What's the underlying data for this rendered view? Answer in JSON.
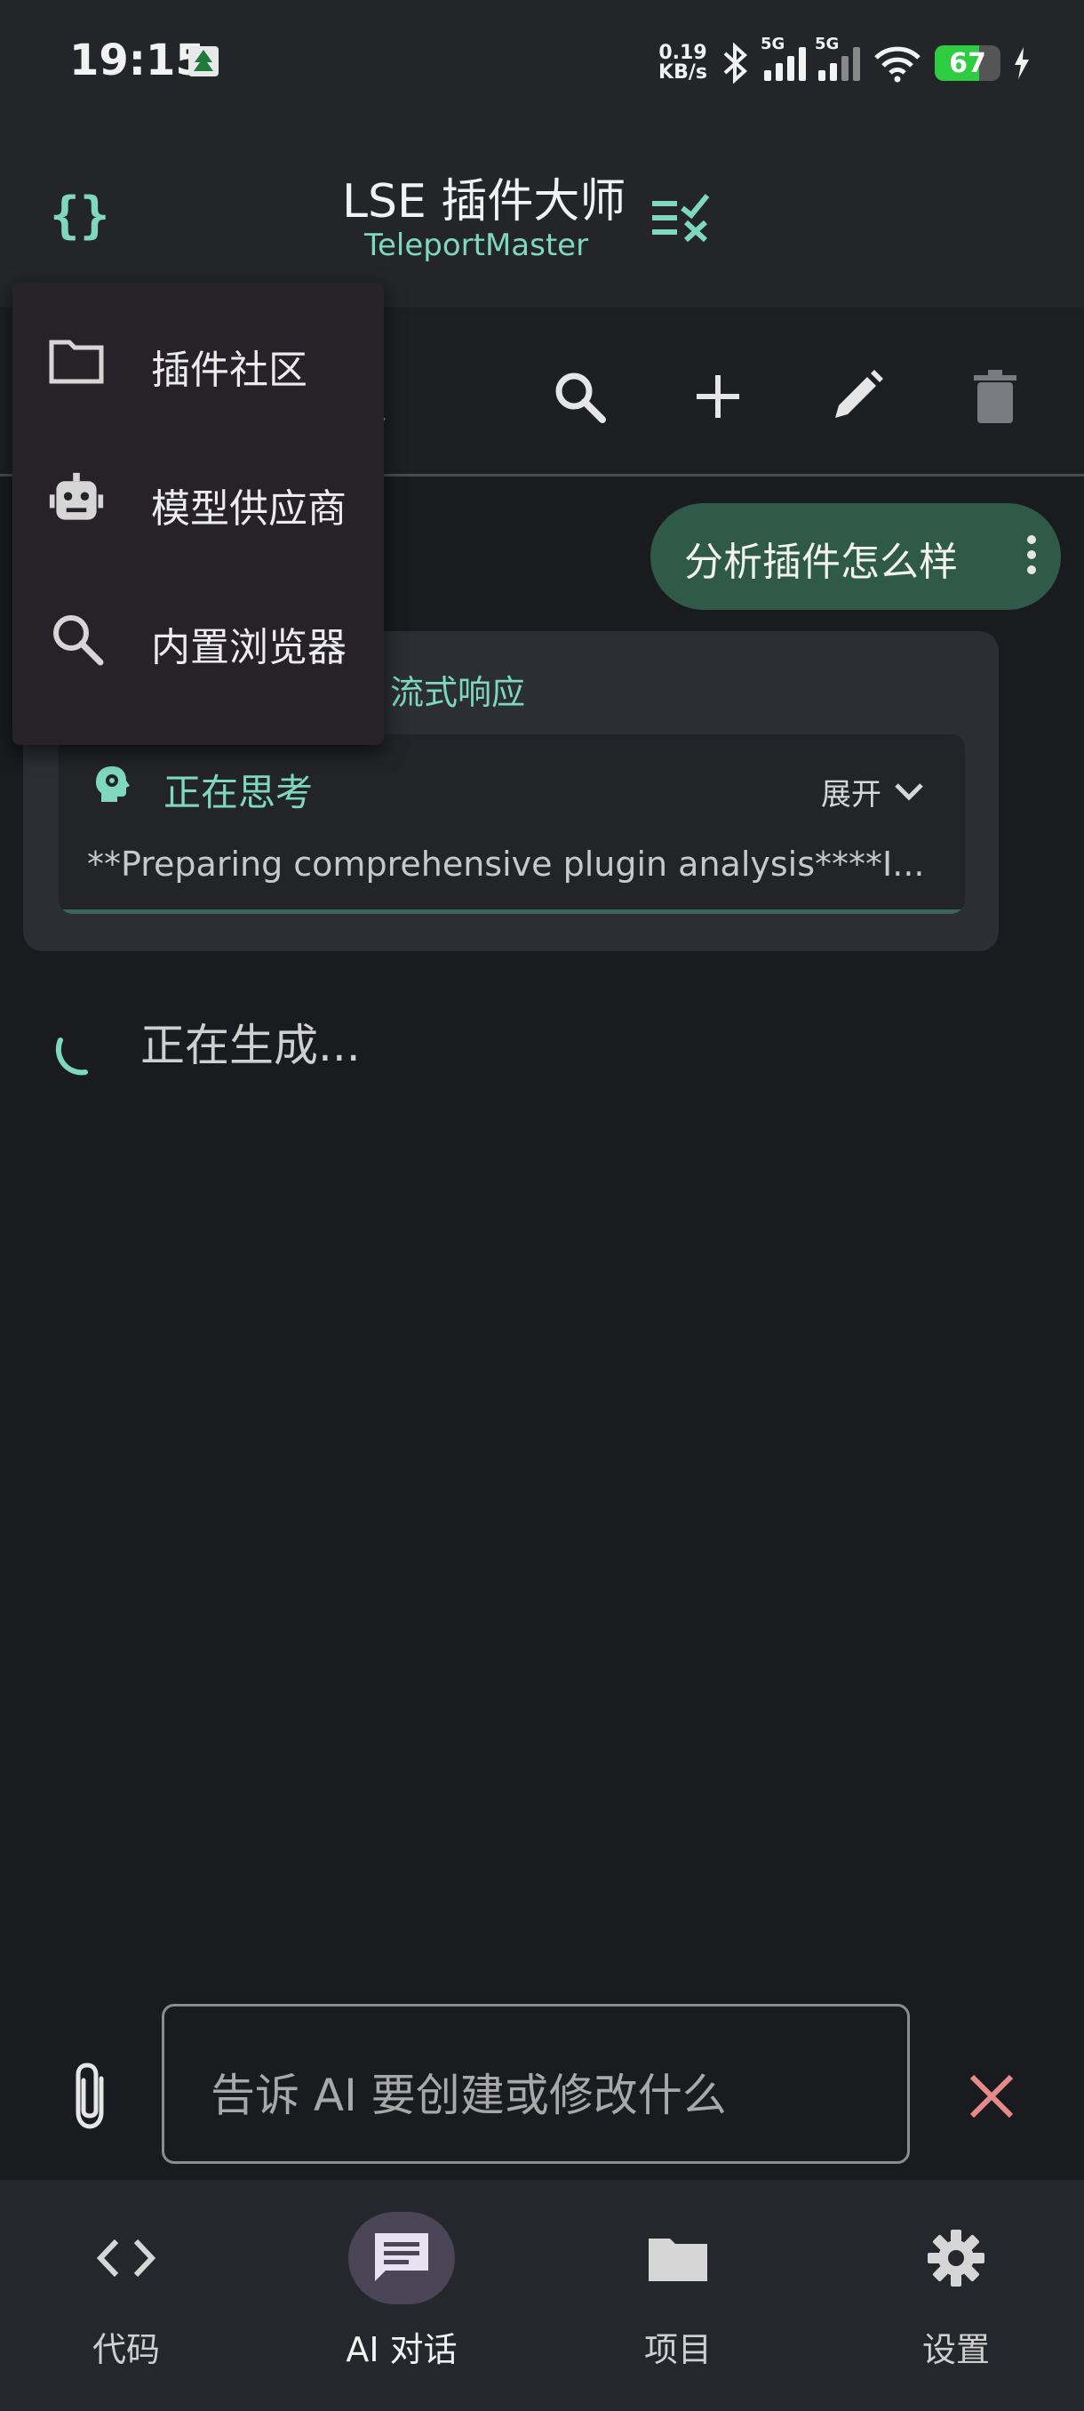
{
  "status_bar": {
    "time": "19:15",
    "net_speed_top": "0.19",
    "net_speed_bottom": "KB/s",
    "sim1_label": "5G",
    "sim2_label": "5G",
    "battery_level": "67",
    "battery_percent": 67
  },
  "app_bar": {
    "title": "LSE 插件大师",
    "subtitle": "TeleportMaster"
  },
  "toolbar": {
    "subtitle_fragment": "r"
  },
  "menu": {
    "items": [
      {
        "label": "插件社区",
        "icon": "folder-icon"
      },
      {
        "label": "模型供应商",
        "icon": "robot-icon"
      },
      {
        "label": "内置浏览器",
        "icon": "search-icon"
      }
    ]
  },
  "chat": {
    "user_message": "分析插件怎么样",
    "stream_label": "流式响应",
    "thinking_title": "正在思考",
    "expand_label": "展开",
    "thinking_text": "**Preparing comprehensive plugin analysis****I...",
    "generating": "正在生成..."
  },
  "input": {
    "placeholder": "告诉 AI 要创建或修改什么"
  },
  "bottom_nav": {
    "items": [
      {
        "label": "代码",
        "icon": "code-icon"
      },
      {
        "label": "AI 对话",
        "icon": "chat-icon"
      },
      {
        "label": "项目",
        "icon": "folder-icon"
      },
      {
        "label": "设置",
        "icon": "gear-icon"
      }
    ],
    "active_index": 1
  },
  "colors": {
    "accent": "#7fd8bd",
    "background": "#1a1b1f",
    "user_bubble": "#2f5a49",
    "close_red": "#e88a8a"
  }
}
